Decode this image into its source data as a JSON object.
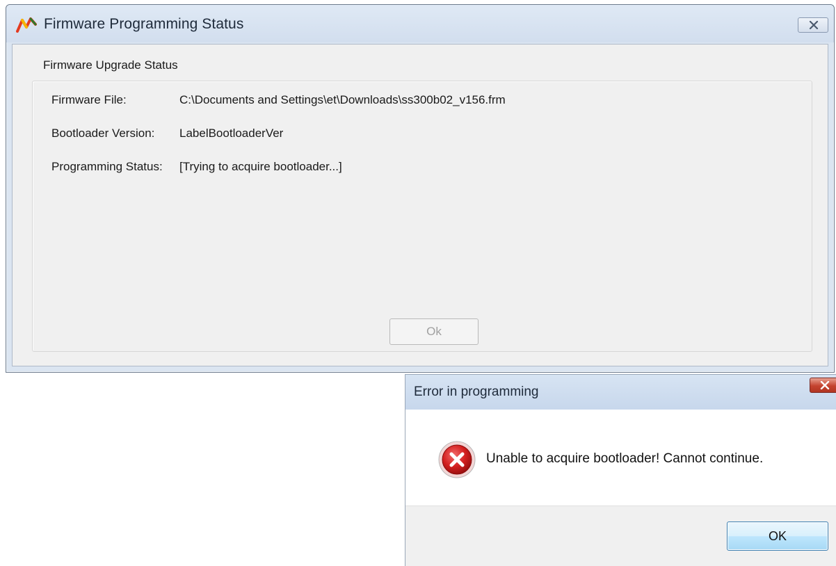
{
  "main_window": {
    "title": "Firmware Programming Status",
    "group_title": "Firmware Upgrade Status",
    "rows": [
      {
        "label": "Firmware File:",
        "value": "C:\\Documents and Settings\\et\\Downloads\\ss300b02_v156.frm"
      },
      {
        "label": "Bootloader Version:",
        "value": "LabelBootloaderVer"
      },
      {
        "label": "Programming Status:",
        "value": "[Trying to acquire bootloader...]"
      }
    ],
    "ok_label": "Ok",
    "icons": {
      "app": "app-graph-icon",
      "close": "close-icon"
    }
  },
  "error_dialog": {
    "title": "Error in programming",
    "message": "Unable to acquire bootloader! Cannot continue.",
    "ok_label": "OK",
    "icons": {
      "error": "error-icon",
      "close": "close-icon"
    }
  },
  "colors": {
    "titlebar": "#d2deee",
    "client_bg": "#f0f0f0",
    "error_close": "#c4432f",
    "error_icon": "#c81e1e",
    "ok_border": "#3c7fb1"
  }
}
